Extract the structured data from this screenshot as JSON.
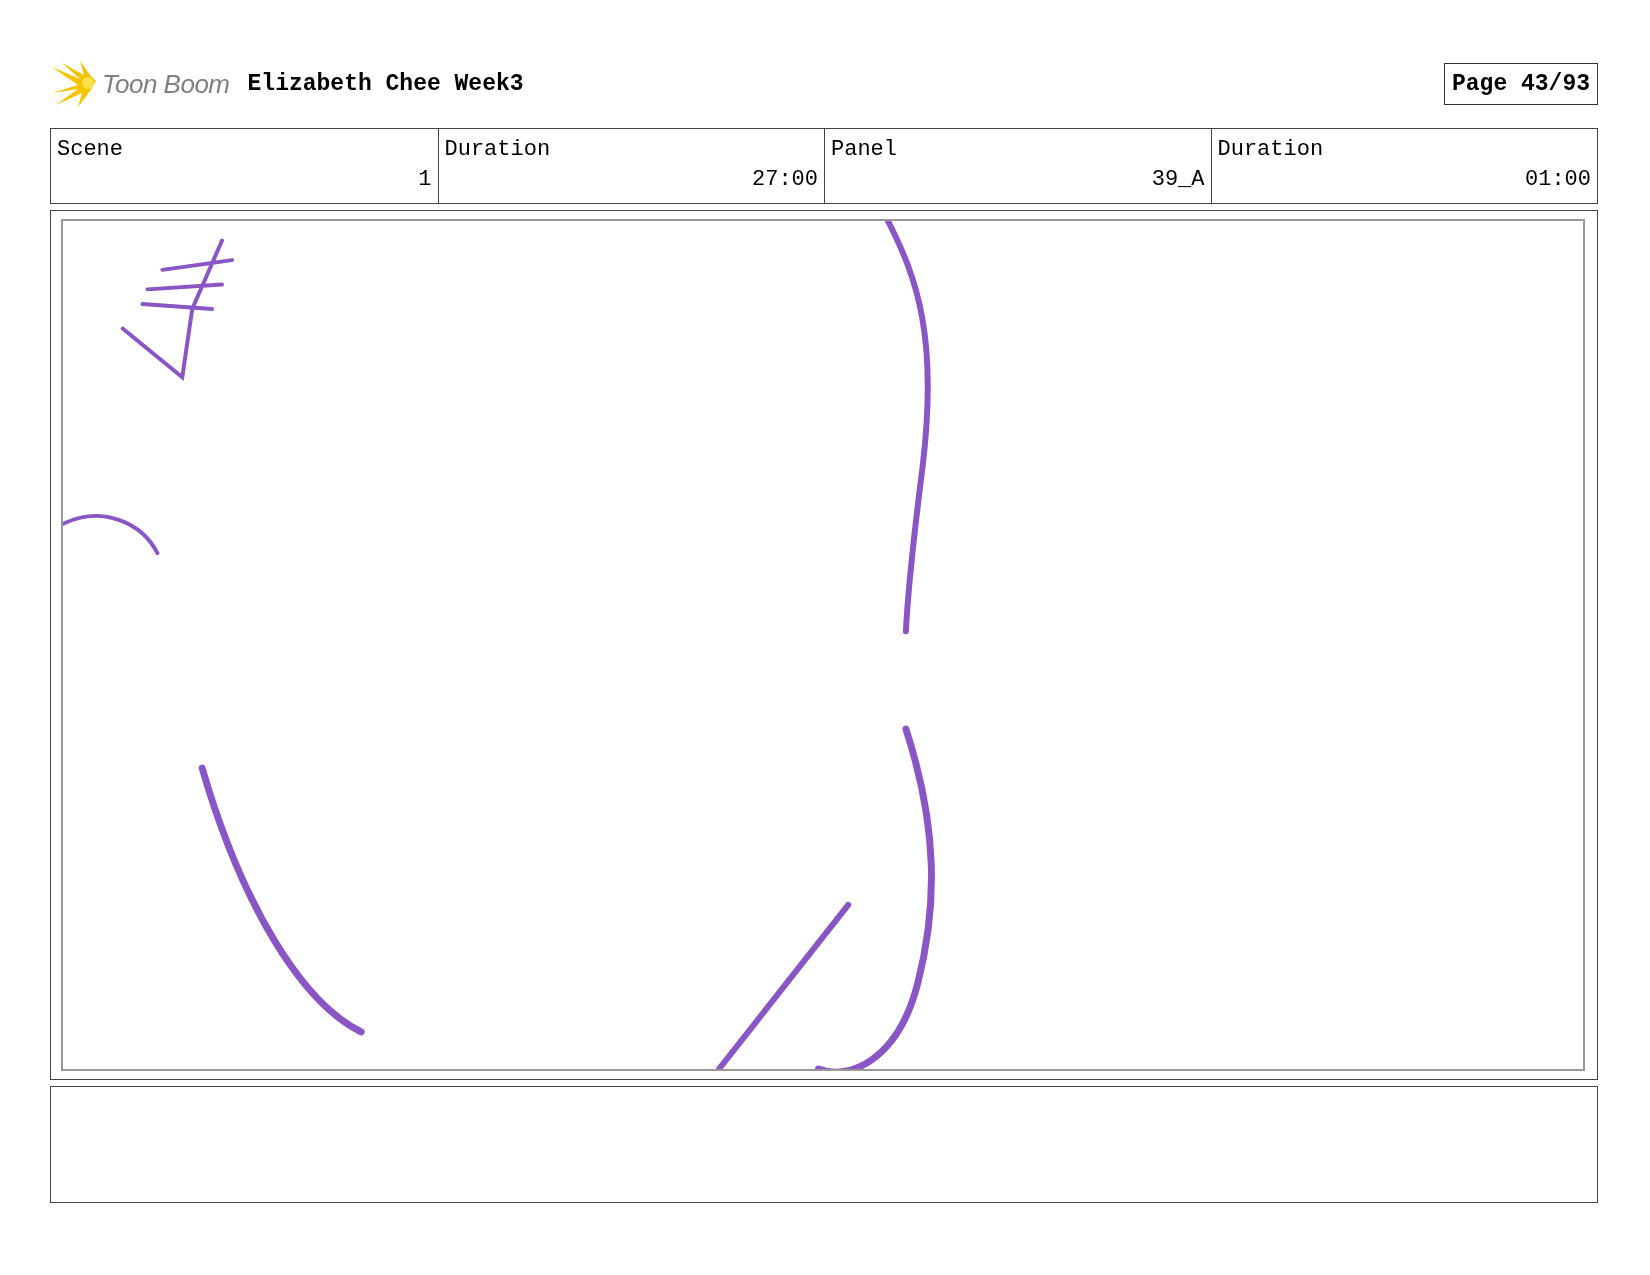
{
  "header": {
    "logo_text": "Toon Boom",
    "title": "Elizabeth Chee Week3",
    "page": "Page 43/93"
  },
  "info_table": {
    "columns": [
      "Scene",
      "Duration",
      "Panel",
      "Duration"
    ],
    "row": [
      "1",
      "27:00",
      "39_A",
      "01:00"
    ]
  }
}
